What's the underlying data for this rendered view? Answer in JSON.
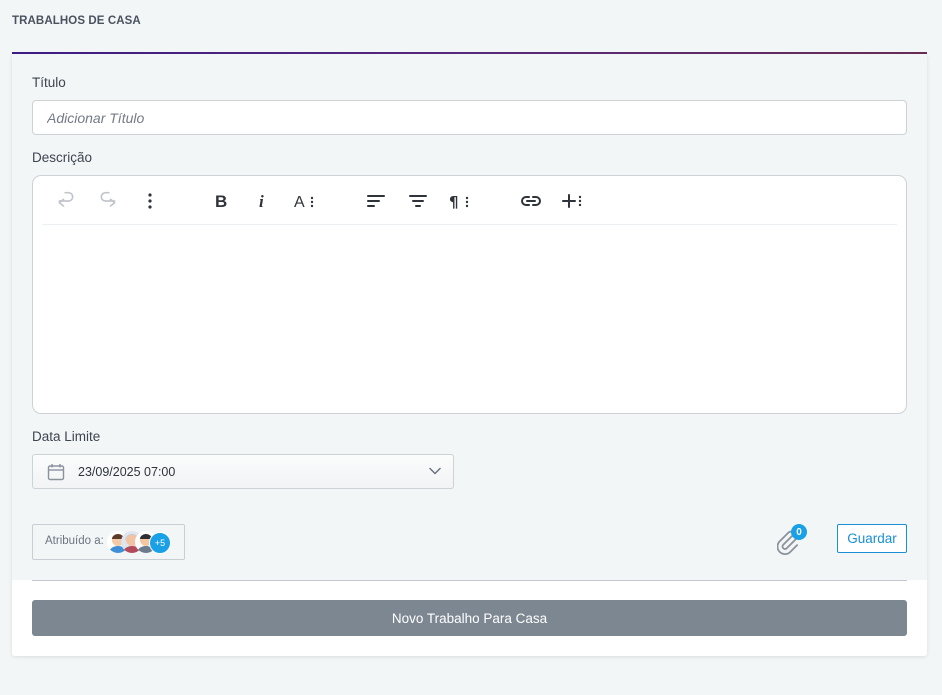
{
  "page": {
    "title": "TRABALHOS DE CASA"
  },
  "form": {
    "title_label": "Título",
    "title_placeholder": "Adicionar Título",
    "description_label": "Descrição",
    "deadline_label": "Data Limite",
    "deadline_value": "23/09/2025 07:00",
    "assigned_label": "Atribuído a:",
    "assigned_more": "+5",
    "attachments_count": "0",
    "save_label": "Guardar",
    "new_label": "Novo Trabalho Para Casa"
  },
  "toolbar": {
    "icons": [
      "undo-icon",
      "redo-icon",
      "more-vertical-icon",
      "bold-icon",
      "italic-icon",
      "font-size-icon",
      "align-left-icon",
      "align-center-icon",
      "paragraph-icon",
      "link-icon",
      "insert-icon"
    ]
  },
  "colors": {
    "accent": "#1a8fd3",
    "badge": "#1aa0e6",
    "primary_button": "#7d8792",
    "header_line": "#3e1d86"
  }
}
